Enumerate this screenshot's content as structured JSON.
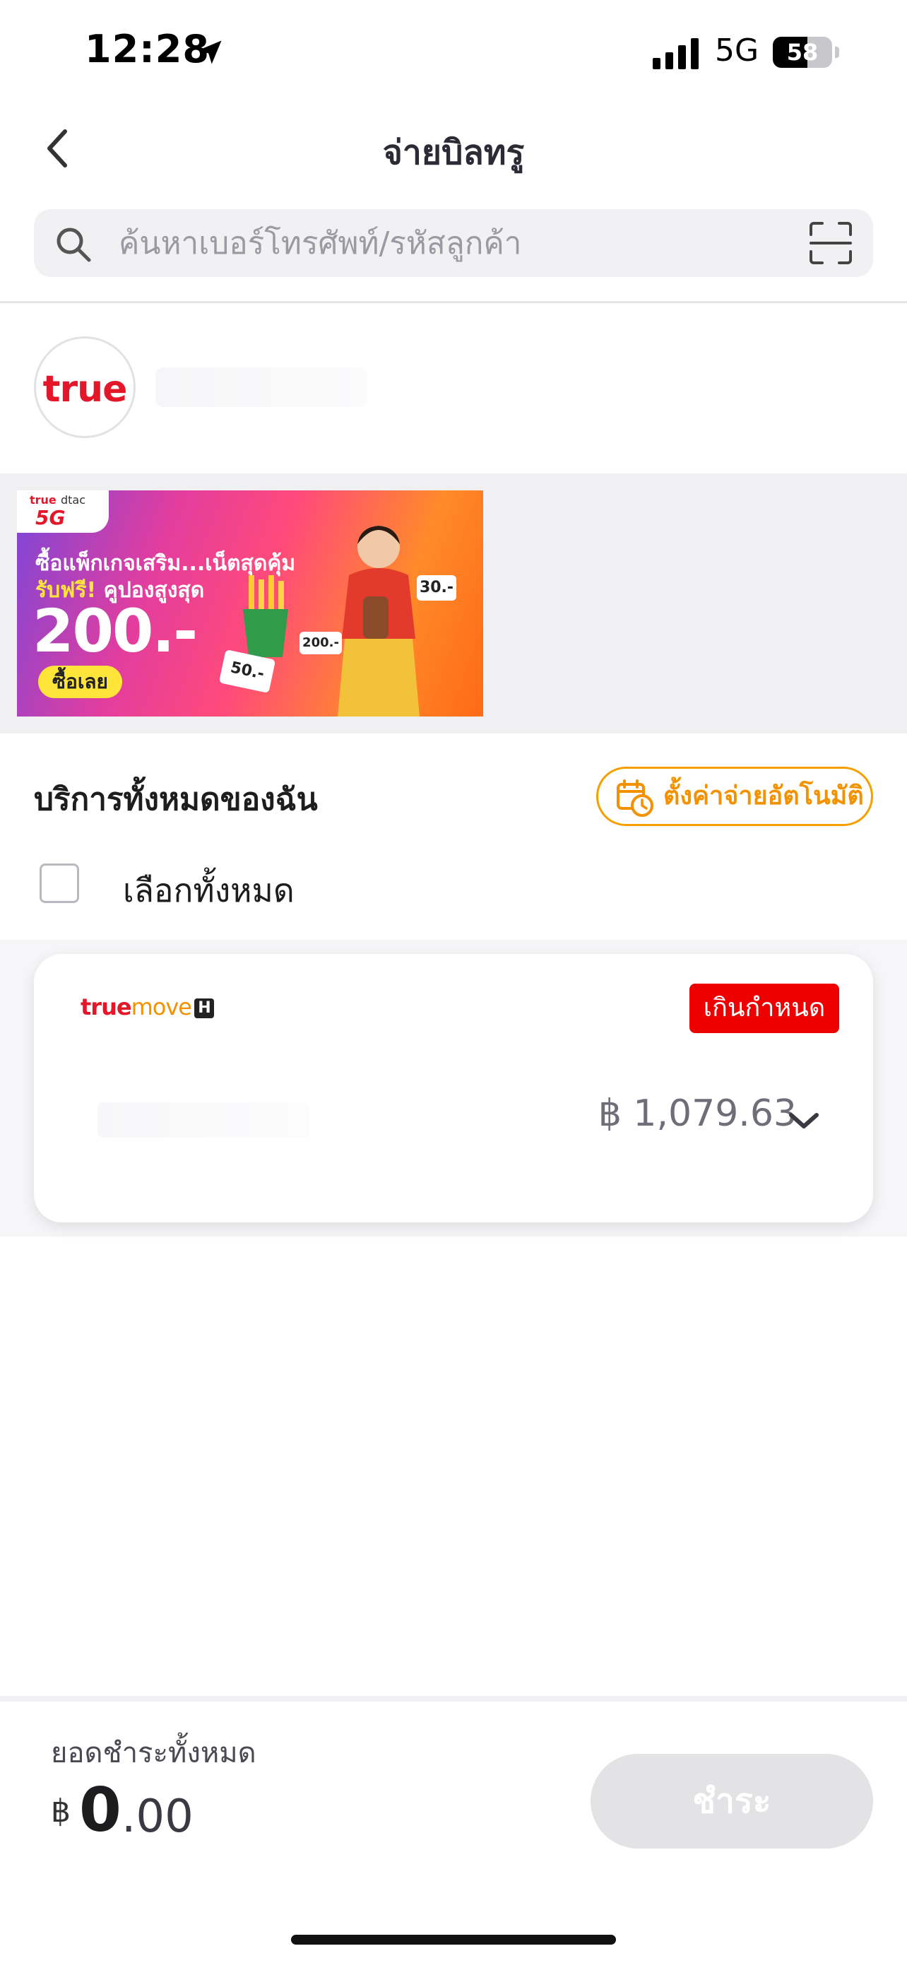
{
  "status_bar": {
    "time": "12:28",
    "network": "5G",
    "battery": "58",
    "battery_level": 0.58
  },
  "header": {
    "title": "จ่ายบิลทรู"
  },
  "search": {
    "placeholder": "ค้นหาเบอร์โทรศัพท์/รหัสลูกค้า"
  },
  "account": {
    "brand": "true"
  },
  "promo": {
    "brand_true": "true",
    "brand_dtac": "dtac",
    "brand_5g": "5G",
    "line1": "ซื้อแพ็กเกจเสริม...เน็ตสุดคุ้ม",
    "line2_highlight": "รับฟรี!",
    "line2_rest": "คูปองสูงสุด",
    "amount": "200.-",
    "cta": "ซื้อเลย",
    "tag_30": "30.-",
    "tag_200": "200.-",
    "tag_50": "50.-"
  },
  "services": {
    "title": "บริการทั้งหมดของฉัน",
    "autopay_label": "ตั้งค่าจ่ายอัตโนมัติ",
    "select_all_label": "เลือกทั้งหมด"
  },
  "bill": {
    "brand_part1": "true",
    "brand_part2": "move",
    "brand_part3": "H",
    "status_badge": "เกินกำหนด",
    "amount": "฿ 1,079.63"
  },
  "footer": {
    "total_label": "ยอดชำระทั้งหมด",
    "currency": "฿",
    "total_main": "0",
    "total_decimal": ".00",
    "pay_button": "ชำระ"
  },
  "colors": {
    "accent": "#f39200",
    "brand_red": "#e4172a",
    "overdue": "#ee0000",
    "disabled": "#e3e3e6"
  }
}
